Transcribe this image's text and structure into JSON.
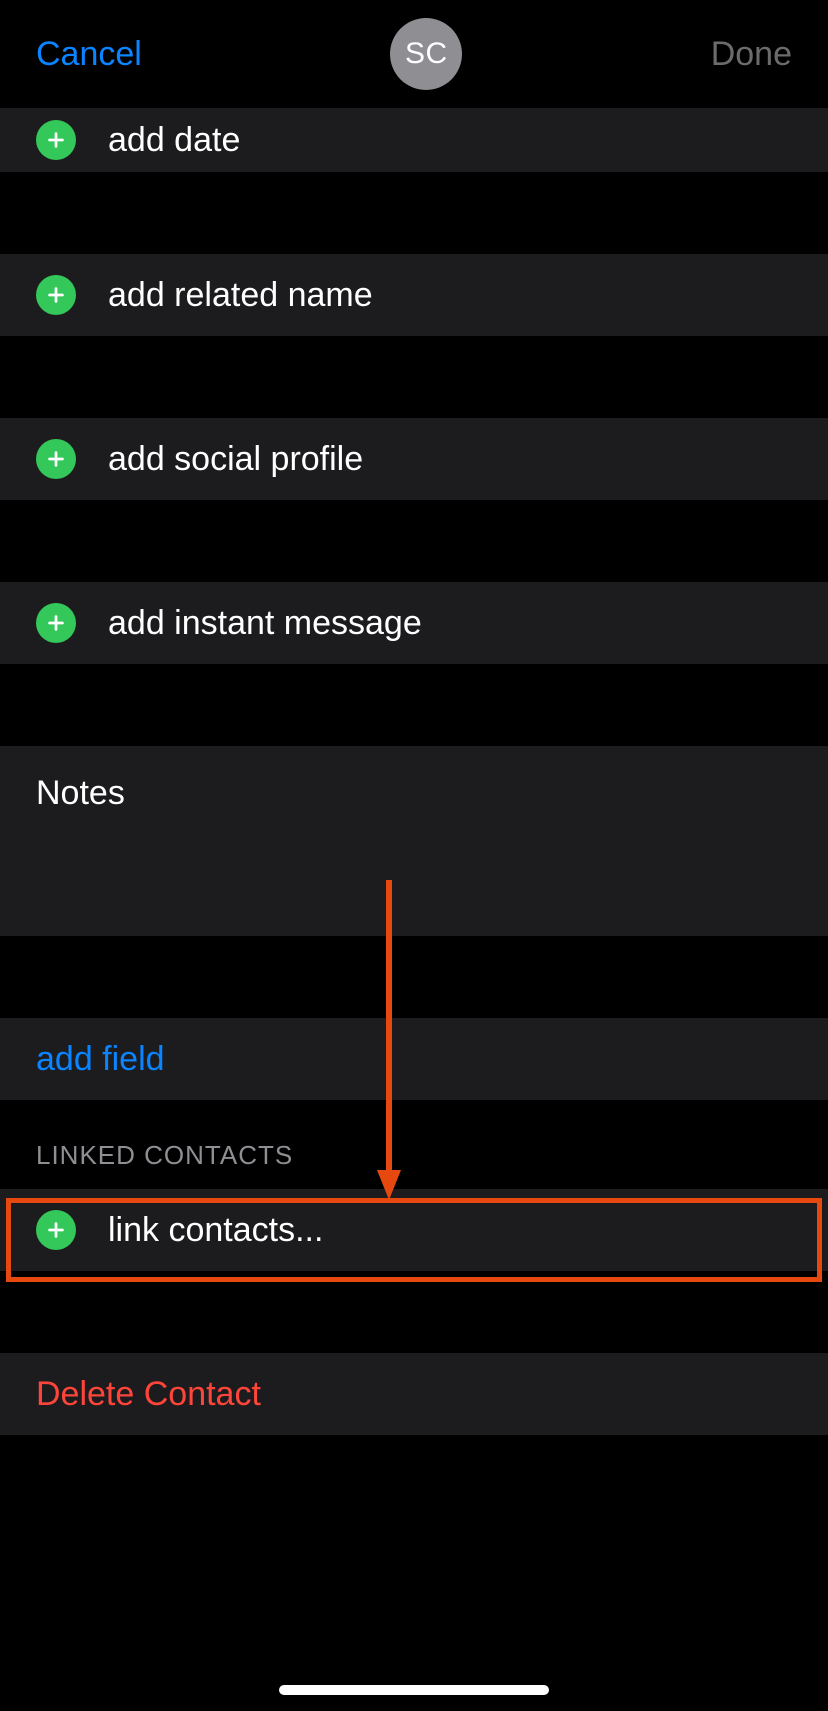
{
  "header": {
    "cancel_label": "Cancel",
    "avatar_initials": "SC",
    "done_label": "Done"
  },
  "rows": {
    "add_date_label": "add date",
    "add_related_name_label": "add related name",
    "add_social_profile_label": "add social profile",
    "add_instant_message_label": "add instant message",
    "notes_label": "Notes",
    "add_field_label": "add field",
    "link_contacts_label": "link contacts...",
    "delete_contact_label": "Delete Contact"
  },
  "sections": {
    "linked_contacts_header": "LINKED CONTACTS"
  },
  "colors": {
    "accent_blue": "#0a84ff",
    "add_green": "#34c759",
    "destructive_red": "#ff453a",
    "highlight_orange": "#e6490f",
    "row_bg": "#1c1c1e",
    "header_secondary": "#8e8e93"
  }
}
